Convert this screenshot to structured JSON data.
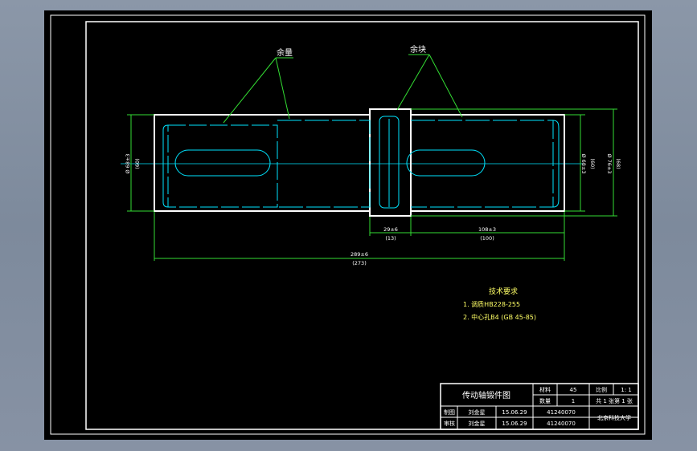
{
  "labels": {
    "allowance_left": "余量",
    "allowance_right": "余块"
  },
  "dimensions": {
    "left_dia": "Ø 68±3",
    "left_dia_ref": "(60)",
    "right_dia_inner": "Ø 68±3",
    "right_dia_inner_ref": "(60)",
    "right_dia_outer": "Ø 76±3",
    "right_dia_outer_ref": "(68)",
    "flange_width": "29±6",
    "flange_width_ref": "(13)",
    "right_len": "108±3",
    "right_len_ref": "(100)",
    "total_len": "289±6",
    "total_len_ref": "(273)"
  },
  "tech_req": {
    "title": "技术要求",
    "item1": "1. 调质HB228-255",
    "item2": "2. 中心孔B4 (GB 45-85)"
  },
  "title_block": {
    "drawing_name": "传动轴锻件图",
    "material_label": "材料",
    "material_value": "45",
    "scale_label": "比例",
    "scale_value": "1: 1",
    "qty_label": "数量",
    "qty_value": "1",
    "sheet_value": "共 1 张第 1 张",
    "drawn_label": "制图",
    "drawn_name": "刘金星",
    "drawn_date": "15.06.29",
    "drawn_no": "41240070",
    "check_label": "审核",
    "check_name": "刘金星",
    "check_date": "15.06.29",
    "check_no": "41240070",
    "org": "北京科技大学"
  },
  "colors": {
    "viewport": "#000000",
    "frame": "#ffffff",
    "part": "#ffffff",
    "hidden": "#00e5ff",
    "leader": "#33dd33",
    "dim_text": "#ffffff",
    "tech_text": "#ffff66"
  }
}
